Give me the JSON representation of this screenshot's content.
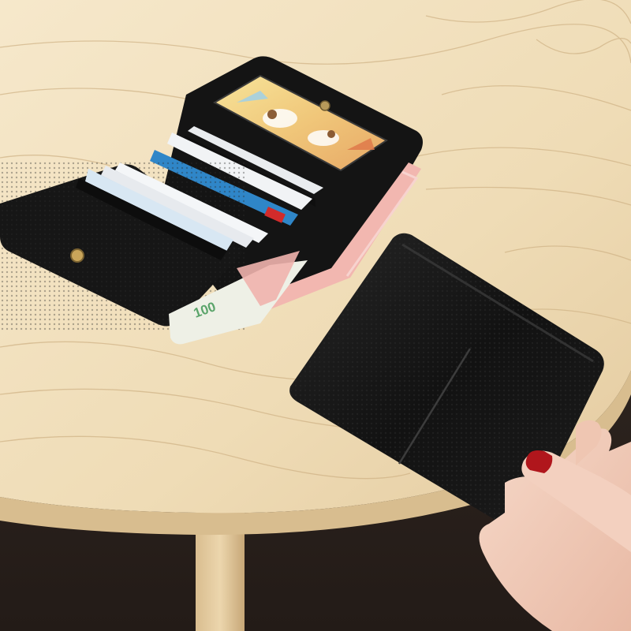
{
  "scene": {
    "banknote_denomination": "100",
    "colors": {
      "table_light": "#f3e3c3",
      "table_mid": "#e8d2aa",
      "wood_grain": "#c9ab7d",
      "table_edge": "#d2b688",
      "floor_dark": "#2e2520",
      "leather": "#161616",
      "leather_highlight": "#2b2b2b",
      "banknote_pink": "#f2b7b0",
      "banknote_green": "#5aa46a",
      "card_blue": "#2f86c8",
      "card_white": "#f4f6f8",
      "snap_gold": "#c9a55a",
      "skin": "#f2cdbb",
      "nail_red": "#b0161c"
    }
  }
}
